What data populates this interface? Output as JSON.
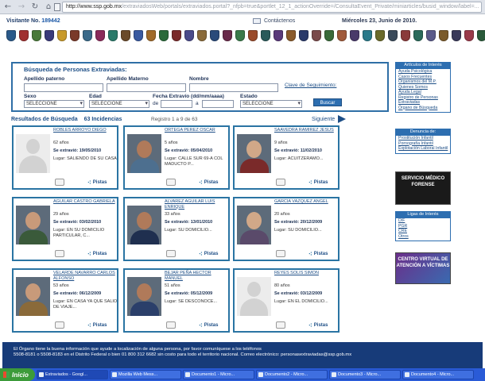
{
  "browser": {
    "back_icon": "arrow-left-icon",
    "forward_icon": "arrow-right-icon",
    "reload_icon": "reload-icon",
    "home_icon": "home-icon",
    "url_host": "http://www.ssp.gob.mx",
    "url_rest": "/extraviadosWeb/portals/extraviados.portal?_nfpb=true&portlet_12_1_actionOverride=/ConsultaEvent_Private/miniarticles/busid_window/label=..."
  },
  "header": {
    "visitor_label": "Visitante No.",
    "visitor_number": "189442",
    "contact_label": "Contáctenos",
    "date": "Miércoles 23, Junio de 2010."
  },
  "emblems": [
    "#2b5a8a",
    "#a03030",
    "#4a7a3a",
    "#3a3a7a",
    "#c89a2a",
    "#7a3a2a",
    "#3a6a8a",
    "#8a2a5a",
    "#2a7a6a",
    "#6a4a2a",
    "#3a5aa0",
    "#a06a2a",
    "#2a6a3a",
    "#7a2a2a",
    "#4a4a8a",
    "#8a6a3a",
    "#2a4a7a",
    "#6a2a4a",
    "#3a7a4a",
    "#9a4a2a",
    "#2a5a5a",
    "#5a3a7a",
    "#8a5a2a",
    "#2a3a6a",
    "#7a4a4a",
    "#3a6a3a",
    "#a05a3a",
    "#4a3a6a",
    "#2a7a8a",
    "#6a6a2a",
    "#3a4a5a",
    "#8a3a3a",
    "#2a6a5a",
    "#5a5a8a",
    "#7a5a2a",
    "#3a3a5a",
    "#9a3a4a",
    "#2a5a3a",
    "#6a3a5a",
    "#4a6a7a"
  ],
  "search": {
    "title": "Búsqueda de Personas Extraviadas:",
    "apellido_paterno": "Apellido paterno",
    "apellido_materno": "Apellido Materno",
    "nombre": "Nombre",
    "clave": "Clave de Seguimiento:",
    "sexo": "Sexo",
    "edad": "Edad",
    "fecha": "Fecha Extravío  (dd/mm/aaaa)",
    "fecha_de": "de",
    "fecha_a": "a",
    "estado": "Estado",
    "select_value": "SELECCIONE",
    "buscar": "Buscar"
  },
  "results": {
    "label": "Resultados de Búsqueda",
    "count": "63  Incidencias",
    "registro": "Registro 1 a 9 de 63",
    "siguiente": "Siguiente"
  },
  "cards": [
    {
      "name": "ROBLES ARROYO DIEGO",
      "age": "62  años",
      "date": "19/05/2010",
      "lugar": "SALIENDO DE SU CASA",
      "photo": "none"
    },
    {
      "name": "ORTEGA PEREZ OSCAR",
      "age": "5  años",
      "date": "05/04/2010",
      "lugar": "CALLE SUR 69-A COL MADUCTO P...",
      "photo": "real"
    },
    {
      "name": "SAAVEDRA RAMIREZ JESUS",
      "age": "9  años",
      "date": "11/02/2010",
      "lugar": "ACUITZERAMO...",
      "photo": "real"
    },
    {
      "name": "AGUILAR CASTRO GABRIELA",
      "age": "29  años",
      "date": "03/02/2010",
      "lugar": "EN SU DOMICILIO PARTICULAR, C...",
      "photo": "real"
    },
    {
      "name": "ALVAREZ AGUILAR LUIS ENRIQUE",
      "age": "33  años",
      "date": "13/01/2010",
      "lugar": "SU DOMICILIO...",
      "photo": "real"
    },
    {
      "name": "GARCIA VAZQUEZ ANGEL",
      "age": "20  años",
      "date": "20/12/2009",
      "lugar": "SU DOMICILIO...",
      "photo": "real"
    },
    {
      "name": "VELARDE NAVARRO CARLOS ALFONSO",
      "age": "53  años",
      "date": "06/12/2009",
      "lugar": "EN CASA YA QUE SALIO DE VIAJE...",
      "photo": "real"
    },
    {
      "name": "BEJAR PEÑA HECTOR MANUEL",
      "age": "51  años",
      "date": "05/12/2009",
      "lugar": "SE DESCONOCE...",
      "photo": "real"
    },
    {
      "name": "REYES SOLIS SIMON",
      "age": "80  años",
      "date": "03/12/2009",
      "lugar": "EN EL DOMICILIO...",
      "photo": "none"
    }
  ],
  "card_labels": {
    "extravio": "Se extravió:",
    "lugar": "Lugar:",
    "pistas": "Pistas"
  },
  "sidebar": {
    "interes_title": "Artículos de Interés",
    "interes_items": [
      "Ayuda Psicológica",
      "Casos Frecuentes",
      "Organismos del M.P.",
      "Quienes Somos",
      "Ayuda Legal",
      "Registro de Personas Extraviadas",
      "Órgano de Búsqueda"
    ],
    "delitos_title": "Denuncia de:",
    "delitos_items": [
      "Prostitución Infantil",
      "Pornografía Infantil",
      "Explotación Laboral Infantil"
    ],
    "banner1": "SERVICIO MÉDICO FORENSE",
    "links_title": "Ligas de Interés",
    "links_items": [
      "DIF",
      "PGR",
      "CRE",
      "Otros"
    ],
    "banner2": "CENTRO VIRTUAL DE ATENCIÓN A VÍCTIMAS"
  },
  "footer": {
    "line1": "El Órgano tiene la buena información que ayude a localización de alguna persona, por favor comuníquese a los teléfonos",
    "line2": "5508-8181 o 5508-8183 en el Distrito Federal o bien 01 800 312 6682 sin costo para todo el territorio nacional. Correo electrónico: personasextraviadas@ssp.gob.mx"
  },
  "taskbar": {
    "start": "Inicio",
    "tasks": [
      "Extraviados - Googl...",
      "Mozilla Web Mess...",
      "Documento1 - Micro...",
      "Documento2 - Micro...",
      "Documento3 - Micro...",
      "Documento4 - Micro..."
    ]
  }
}
